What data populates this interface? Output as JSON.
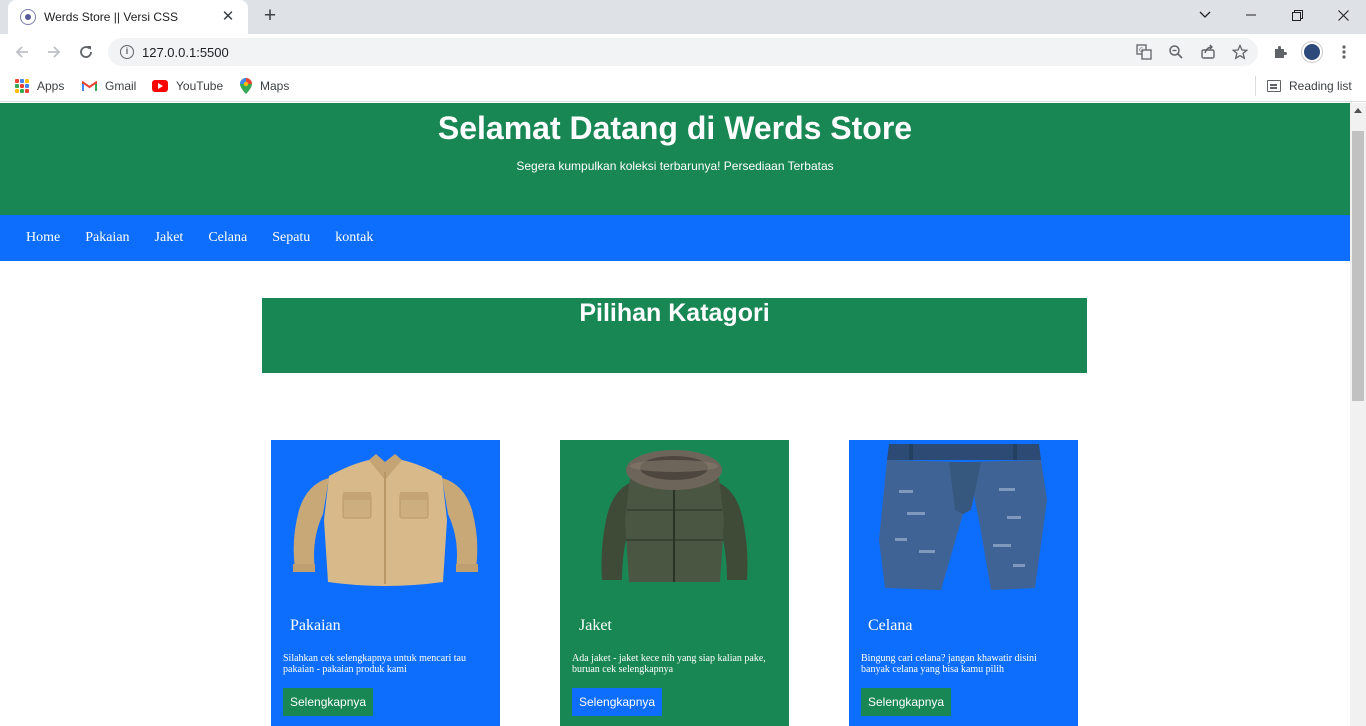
{
  "browser": {
    "tab_title": "Werds Store || Versi CSS",
    "url": "127.0.0.1:5500",
    "bookmarks": [
      "Apps",
      "Gmail",
      "YouTube",
      "Maps"
    ],
    "reading_list": "Reading list"
  },
  "header": {
    "title": "Selamat Datang di Werds Store",
    "tagline": "Segera kumpulkan koleksi terbarunya! Persediaan Terbatas"
  },
  "nav": [
    "Home",
    "Pakaian",
    "Jaket",
    "Celana",
    "Sepatu",
    "kontak"
  ],
  "section": {
    "title": "Pilihan Katagori"
  },
  "cards": [
    {
      "title": "Pakaian",
      "description": "Silahkan cek selengkapnya untuk mencari tau pakaian - pakaian produk kami",
      "button": "Selengkapnya",
      "card_color": "#0d6efd",
      "button_color": "#198754",
      "image_icon": "shirt-image"
    },
    {
      "title": "Jaket",
      "description": "Ada jaket - jaket kece nih yang siap kalian pake, buruan cek selengkapnya",
      "button": "Selengkapnya",
      "card_color": "#198754",
      "button_color": "#0d6efd",
      "image_icon": "jacket-image"
    },
    {
      "title": "Celana",
      "description": "Bingung cari celana? jangan khawatir disini banyak celana yang bisa kamu pilih",
      "button": "Selengkapnya",
      "card_color": "#0d6efd",
      "button_color": "#198754",
      "image_icon": "jeans-image"
    }
  ],
  "colors": {
    "green": "#198754",
    "blue": "#0d6efd"
  }
}
